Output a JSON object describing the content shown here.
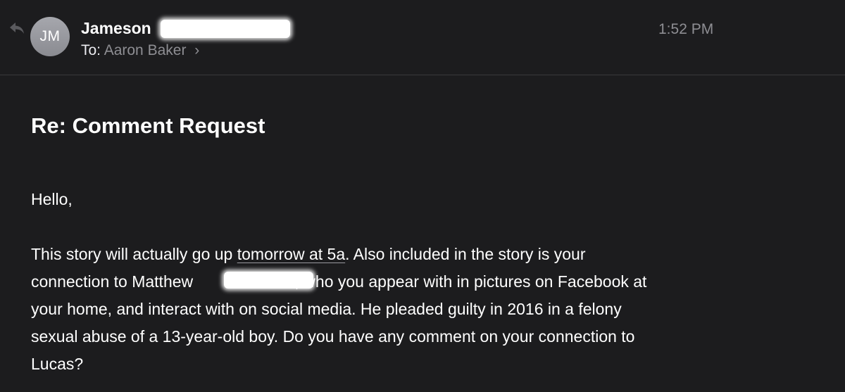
{
  "header": {
    "avatar_initials": "JM",
    "sender_name": "Jameson",
    "to_label": "To:",
    "recipient": "Aaron Baker",
    "time": "1:52 PM"
  },
  "message": {
    "subject": "Re: Comment Request",
    "greeting": "Hello,",
    "lines": [
      {
        "pre": "This story will actually go up ",
        "link": "tomorrow at 5a",
        "post": ". Also included in the story is your"
      },
      {
        "pre": "connection to Matthew ",
        "post": ", who you appear with in pictures on Facebook at"
      },
      {
        "text": "your home, and interact with on social media. He pleaded guilty in 2016 in a felony"
      },
      {
        "text": "sexual abuse of a 13-year-old boy. Do you have any comment on your connection to"
      },
      {
        "text": "Lucas?"
      }
    ]
  }
}
